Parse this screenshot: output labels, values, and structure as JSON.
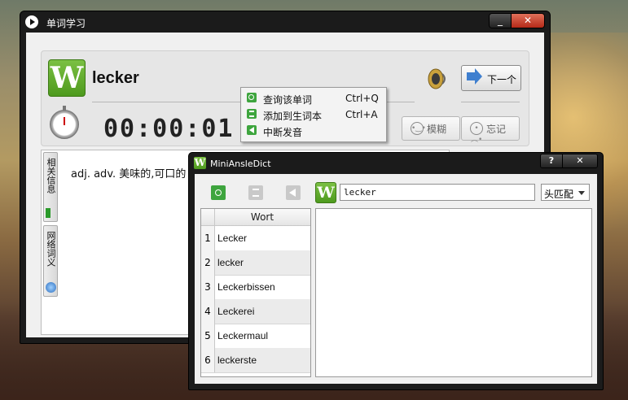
{
  "main_window": {
    "title": "单词学习",
    "min_symbol": "_",
    "close_symbol": "✕",
    "logo_letter": "W",
    "word": "lecker",
    "next_label": "下一个",
    "timer": "00:00:01",
    "fuzzy_label": "模糊",
    "forget_label": "忘记",
    "tabs": [
      "相关信息",
      "网络词义"
    ],
    "meaning": "adj. adv. 美味的,可口的"
  },
  "context_menu": {
    "items": [
      {
        "label": "查询该单词",
        "shortcut": "Ctrl+Q",
        "icon": "search-icon"
      },
      {
        "label": "添加到生词本",
        "shortcut": "Ctrl+A",
        "icon": "hourglass-icon"
      },
      {
        "label": "中断发音",
        "shortcut": "",
        "icon": "speaker-icon"
      }
    ]
  },
  "dict_window": {
    "title": "MiniAnsleDict",
    "help_symbol": "?",
    "close_symbol": "✕",
    "logo_letter": "W",
    "search_value": "lecker",
    "match_mode": "头匹配",
    "column_header": "Wort",
    "rows": [
      {
        "num": "1",
        "word": "Lecker"
      },
      {
        "num": "2",
        "word": "lecker"
      },
      {
        "num": "3",
        "word": "Leckerbissen"
      },
      {
        "num": "4",
        "word": "Leckerei"
      },
      {
        "num": "5",
        "word": "Leckermaul"
      },
      {
        "num": "6",
        "word": "leckerste"
      }
    ]
  },
  "colors": {
    "accent_green": "#4e9a1e",
    "titlebar": "#1b1b1b",
    "close_red": "#b52a18"
  }
}
